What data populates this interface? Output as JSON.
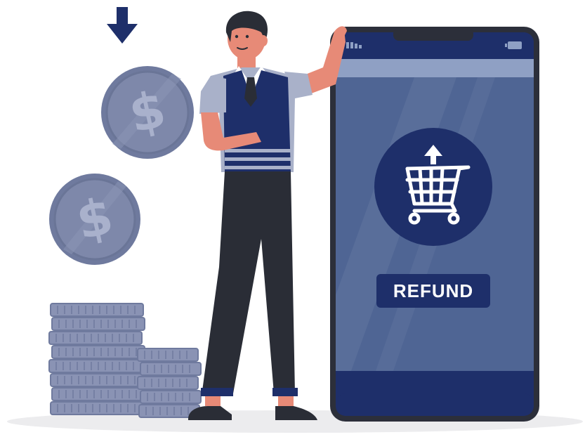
{
  "refund_button": {
    "label": "REFUND"
  },
  "icons": {
    "download_arrow": "arrow-down-icon",
    "coin": "dollar-coin-icon",
    "cart": "shopping-cart-icon",
    "upload_arrow": "arrow-up-icon",
    "battery": "battery-icon",
    "signal": "signal-icon"
  },
  "colors": {
    "navy": "#1e2f6a",
    "phone_body": "#2c2f3a",
    "screen": "#4f6594",
    "coin": "#7b85a8",
    "coin_stack": "#8a93b4",
    "skin": "#e78a77",
    "shirt": "#a9b1c9",
    "trousers": "#2a2d36",
    "ground": "#ececee"
  }
}
